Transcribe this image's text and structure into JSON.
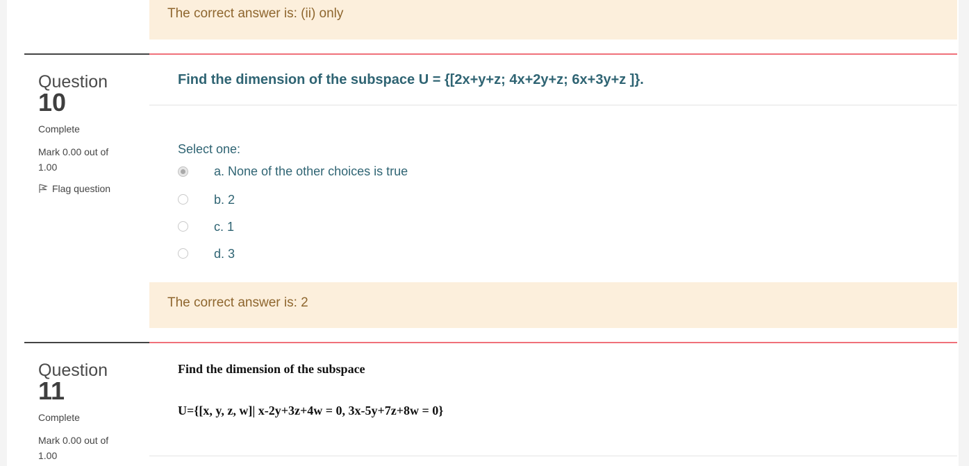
{
  "prev_feedback": {
    "text": "The correct answer is: (ii) only"
  },
  "q10": {
    "word": "Question",
    "number": "10",
    "state": "Complete",
    "mark": "Mark 0.00 out of 1.00",
    "flag_label": "Flag question",
    "text": "Find the dimension of the subspace U = {[2x+y+z; 4x+2y+z; 6x+3y+z ]}.",
    "prompt": "Select one:",
    "answers": [
      {
        "label": "a. None of the other choices is true",
        "checked": true
      },
      {
        "label": "b. 2",
        "checked": false
      },
      {
        "label": "c. 1",
        "checked": false
      },
      {
        "label": "d. 3",
        "checked": false
      }
    ],
    "feedback": "The correct answer is: 2"
  },
  "q11": {
    "word": "Question",
    "number": "11",
    "state": "Complete",
    "mark": "Mark 0.00 out of 1.00",
    "text_line1": "Find the dimension of the subspace",
    "text_line2": "U={[x, y, z, w]| x-2y+3z+4w = 0, 3x-5y+7z+8w = 0}"
  },
  "colors": {
    "feedback_bg": "#fcefdc",
    "feedback_text": "#8e662e",
    "accent_rule": "#f0707a",
    "question_text": "#2f6473"
  }
}
